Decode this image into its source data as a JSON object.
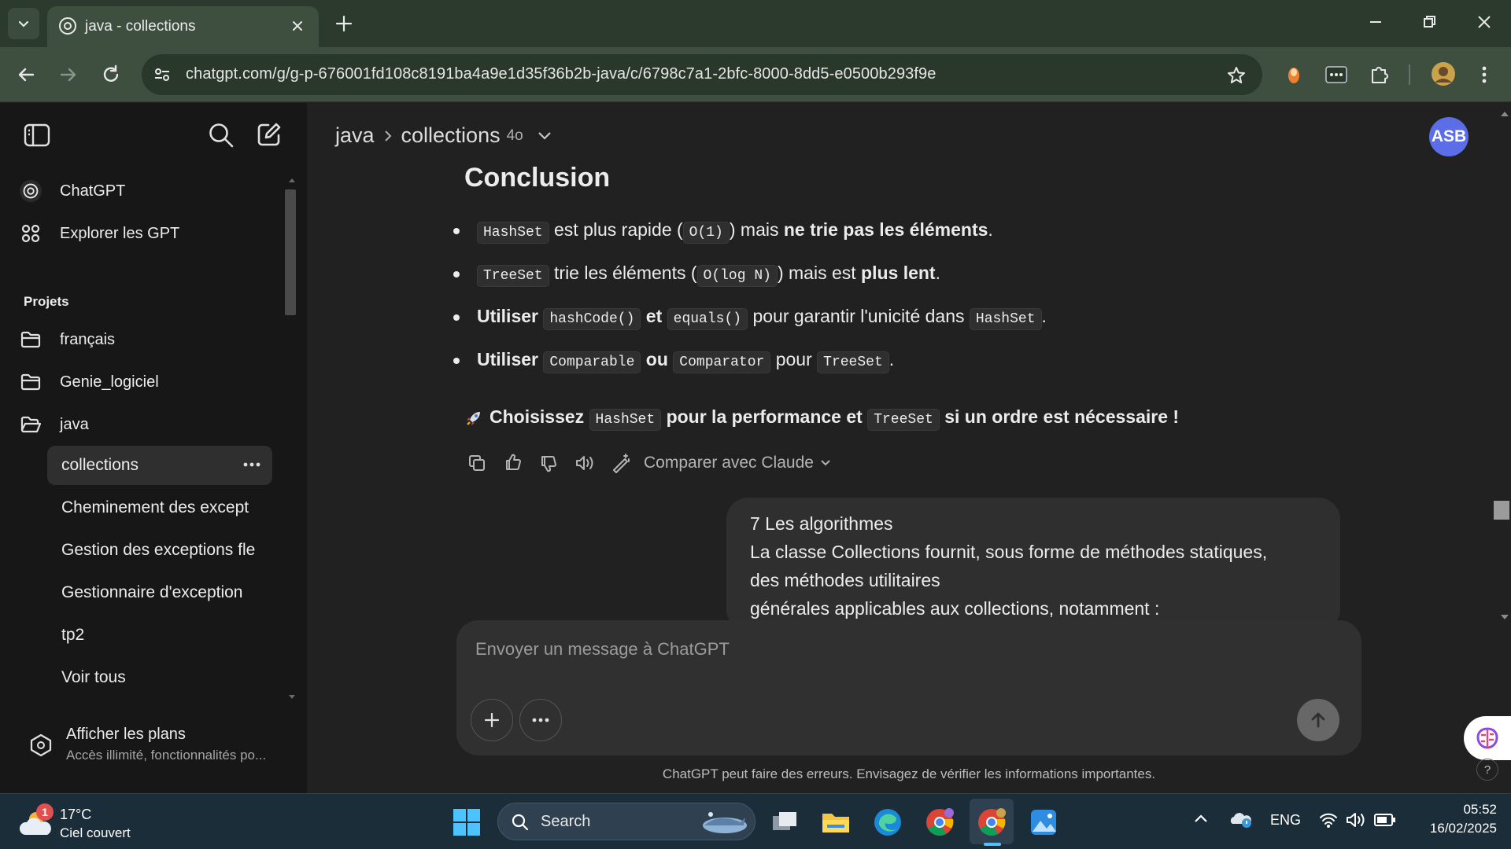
{
  "browser": {
    "tab_title": "java - collections",
    "url": "chatgpt.com/g/g-p-676001fd108c8191ba4a9e1d35f36b2b-java/c/6798c7a1-2bfc-8000-8dd5-e0500b293f9e"
  },
  "sidebar": {
    "top_items": [
      {
        "label": "ChatGPT",
        "icon": "chatgpt-logo-icon"
      },
      {
        "label": "Explorer les GPT",
        "icon": "grid-icon"
      }
    ],
    "projects_heading": "Projets",
    "projects": [
      {
        "label": "français",
        "icon": "folder-icon"
      },
      {
        "label": "Genie_logiciel",
        "icon": "folder-icon"
      },
      {
        "label": "java",
        "icon": "folder-open-icon"
      }
    ],
    "java_chats": [
      {
        "label": "collections",
        "active": true
      },
      {
        "label": "Cheminement des except"
      },
      {
        "label": "Gestion des exceptions fle"
      },
      {
        "label": "Gestionnaire d'exception"
      },
      {
        "label": "tp2"
      },
      {
        "label": "Voir tous"
      }
    ],
    "plans": {
      "title": "Afficher les plans",
      "subtitle": "Accès illimité, fonctionnalités po..."
    }
  },
  "header": {
    "project": "java",
    "chat": "collections",
    "model": "4o",
    "avatar": "ASB"
  },
  "message": {
    "heading": "Conclusion",
    "bullets": [
      {
        "c1": "HashSet",
        "t1": " est plus rapide (",
        "c2": "O(1)",
        "t2": ") mais ",
        "b": "ne trie pas les éléments",
        "t3": "."
      },
      {
        "c1": "TreeSet",
        "t1": " trie les éléments (",
        "c2": "O(log N)",
        "t2": ") mais est ",
        "b": "plus lent",
        "t3": "."
      },
      {
        "b1": "Utiliser",
        "c1": "hashCode()",
        "b2": "et",
        "c2": "equals()",
        "t1": " pour garantir l'unicité dans ",
        "c3": "HashSet",
        "t2": "."
      },
      {
        "b1": "Utiliser",
        "c1": "Comparable",
        "b2": "ou",
        "c2": "Comparator",
        "t1": " pour ",
        "c3": "TreeSet",
        "t2": "."
      }
    ],
    "final": {
      "b1": "Choisissez",
      "c1": "HashSet",
      "b2": "pour la performance et",
      "c2": "TreeSet",
      "b3": "si un ordre est nécessaire !"
    },
    "compare_label": "Comparer avec Claude"
  },
  "user_message": {
    "lines": [
      "7  Les algorithmes",
      " La classe Collections fournit, sous forme de méthodes statiques,",
      "des méthodes utilitaires",
      " générales applicables aux collections, notamment :"
    ]
  },
  "composer": {
    "placeholder": "Envoyer un message à ChatGPT",
    "disclaimer": "ChatGPT peut faire des erreurs. Envisagez de vérifier les informations importantes."
  },
  "taskbar": {
    "weather_temp": "17°C",
    "weather_desc": "Ciel couvert",
    "weather_badge": "1",
    "search_label": "Search",
    "lang": "ENG",
    "time": "05:52",
    "date": "16/02/2025"
  },
  "colors": {
    "accent_avatar": "#5b6ee8",
    "sidebar_bg": "#171717",
    "main_bg": "#212121",
    "chrome_green": "#3e4f3f"
  }
}
